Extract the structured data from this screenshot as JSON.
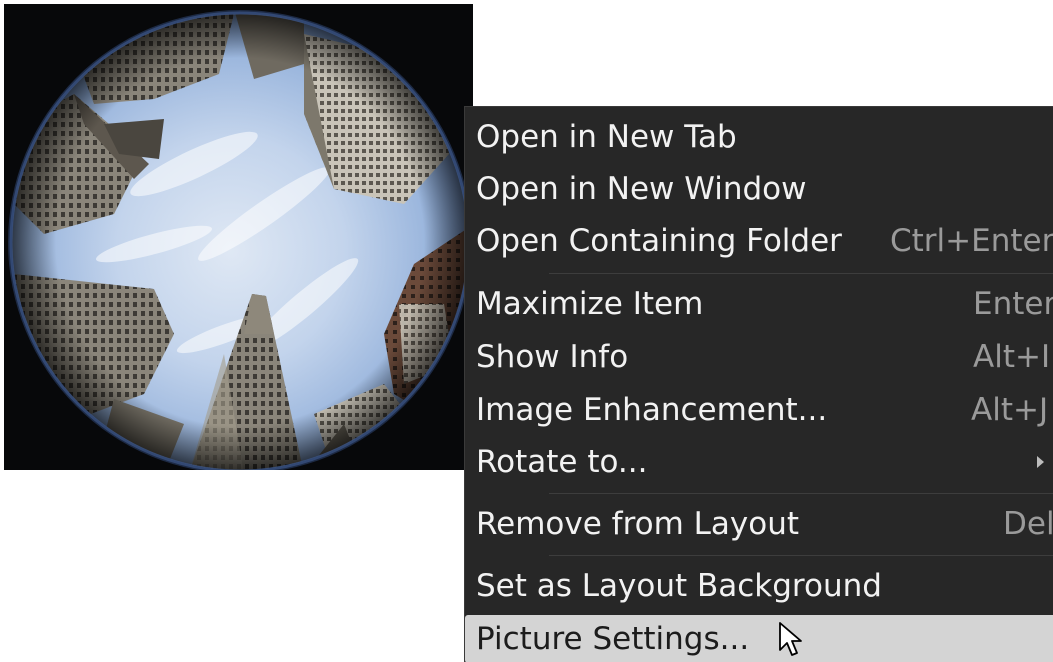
{
  "context_menu": {
    "items": [
      {
        "label": "Open in New Tab",
        "shortcut": ""
      },
      {
        "label": "Open in New Window",
        "shortcut": ""
      },
      {
        "label": "Open Containing Folder",
        "shortcut": "Ctrl+Enter"
      },
      {
        "label": "Maximize Item",
        "shortcut": "Enter"
      },
      {
        "label": "Show Info",
        "shortcut": "Alt+I"
      },
      {
        "label": "Image Enhancement...",
        "shortcut": "Alt+J"
      },
      {
        "label": "Rotate to...",
        "shortcut": "",
        "has_submenu": true
      },
      {
        "label": "Remove from Layout",
        "shortcut": "Del"
      },
      {
        "label": "Set as Layout Background",
        "shortcut": ""
      },
      {
        "label": "Picture Settings...",
        "shortcut": "",
        "highlighted": true
      }
    ],
    "icons": {
      "submenu": "chevron-right-icon",
      "cursor": "mouse-pointer-icon"
    }
  },
  "colors": {
    "menu_background": "#272727",
    "menu_text": "#f2f2f2",
    "shortcut_text": "#9a9a9a",
    "highlight_background": "#d4d4d4",
    "highlight_text": "#1c1c1c"
  }
}
